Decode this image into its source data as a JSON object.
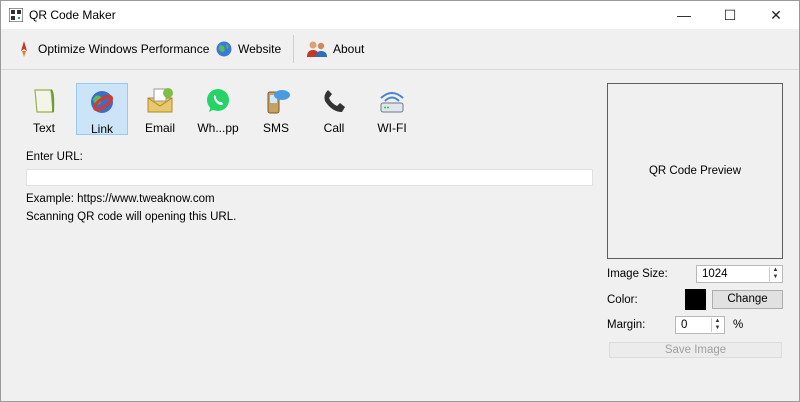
{
  "window": {
    "title": "QR Code Maker",
    "min": "—",
    "max": "☐",
    "close": "✕"
  },
  "toolbar": {
    "optimize": "Optimize Windows Performance",
    "website": "Website",
    "about": "About"
  },
  "types": [
    {
      "label": "Text",
      "icon": "text-icon"
    },
    {
      "label": "Link",
      "icon": "link-icon",
      "selected": true
    },
    {
      "label": "Email",
      "icon": "email-icon"
    },
    {
      "label": "Wh...pp",
      "icon": "whatsapp-icon"
    },
    {
      "label": "SMS",
      "icon": "sms-icon"
    },
    {
      "label": "Call",
      "icon": "phone-icon"
    },
    {
      "label": "WI-FI",
      "icon": "wifi-icon"
    }
  ],
  "form": {
    "url_label": "Enter URL:",
    "url_value": "",
    "example": "Example: https://www.tweaknow.com",
    "note": "Scanning QR code will opening this URL."
  },
  "panel": {
    "preview": "QR Code Preview",
    "size_label": "Image Size:",
    "size_value": "1024",
    "color_label": "Color:",
    "color_value": "#000000",
    "change": "Change",
    "margin_label": "Margin:",
    "margin_value": "0",
    "margin_unit": "%",
    "save": "Save Image"
  }
}
